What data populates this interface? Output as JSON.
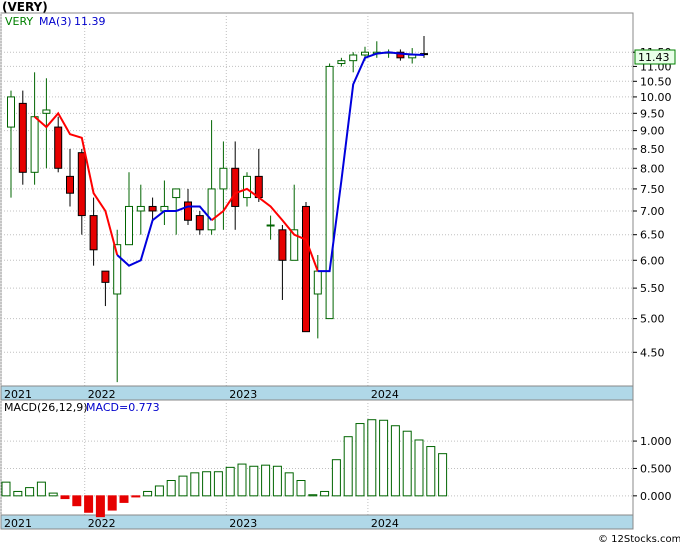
{
  "title": "(VERY)",
  "legend": {
    "symbol": "VERY",
    "ma_label": "MA(3)",
    "ma_value": "11.39",
    "symbol_color": "#008000",
    "ma_color": "#0000cc"
  },
  "last_price_badge": "11.43",
  "watermark": "© 12Stocks.com",
  "macd_legend": {
    "label": "MACD(26,12,9)",
    "value_label": "MACD=0.773"
  },
  "colors": {
    "up_fill": "#ffffff",
    "up_stroke": "#006400",
    "down_fill": "#e60000",
    "ma_red": "#ff0000",
    "ma_blue": "#0000dd",
    "grid": "#c0c0c0",
    "axis_band": "#b0d8e8",
    "badge_bg": "#e8ffe8",
    "badge_border": "#008000"
  },
  "chart_data": [
    {
      "type": "candlestick",
      "scale": "log",
      "ylim": [
        4.05,
        13.0
      ],
      "y_ticks": [
        "11.50",
        "11.00",
        "10.50",
        "10.00",
        "9.50",
        "9.00",
        "8.50",
        "8.00",
        "7.50",
        "7.00",
        "6.50",
        "6.00",
        "5.50",
        "5.00",
        "4.50"
      ],
      "x_ticks": [
        "2021",
        "2022",
        "2023",
        "2024"
      ],
      "x_tick_index": [
        0,
        6.5,
        18.5,
        30.5
      ],
      "candles": [
        {
          "o": 9.1,
          "h": 10.2,
          "l": 7.3,
          "c": 10.0
        },
        {
          "o": 9.8,
          "h": 10.2,
          "l": 7.6,
          "c": 7.9
        },
        {
          "o": 7.9,
          "h": 10.8,
          "l": 7.6,
          "c": 9.4
        },
        {
          "o": 9.5,
          "h": 10.6,
          "l": 8.0,
          "c": 9.6
        },
        {
          "o": 9.1,
          "h": 9.4,
          "l": 7.9,
          "c": 8.0
        },
        {
          "o": 7.8,
          "h": 8.5,
          "l": 7.1,
          "c": 7.4
        },
        {
          "o": 8.4,
          "h": 8.5,
          "l": 6.5,
          "c": 6.9
        },
        {
          "o": 6.9,
          "h": 7.3,
          "l": 5.9,
          "c": 6.2
        },
        {
          "o": 5.8,
          "h": 5.8,
          "l": 5.2,
          "c": 5.6
        },
        {
          "o": 5.4,
          "h": 6.6,
          "l": 4.1,
          "c": 6.3
        },
        {
          "o": 6.3,
          "h": 7.9,
          "l": 6.3,
          "c": 7.1
        },
        {
          "o": 7.0,
          "h": 7.6,
          "l": 6.5,
          "c": 7.1
        },
        {
          "o": 7.1,
          "h": 7.3,
          "l": 6.8,
          "c": 7.0
        },
        {
          "o": 7.0,
          "h": 7.7,
          "l": 6.7,
          "c": 7.1
        },
        {
          "o": 7.3,
          "h": 7.4,
          "l": 6.5,
          "c": 7.5
        },
        {
          "o": 7.2,
          "h": 7.5,
          "l": 6.7,
          "c": 6.8
        },
        {
          "o": 6.9,
          "h": 7.0,
          "l": 6.5,
          "c": 6.6
        },
        {
          "o": 6.6,
          "h": 9.3,
          "l": 6.5,
          "c": 7.5
        },
        {
          "o": 7.5,
          "h": 8.7,
          "l": 6.6,
          "c": 8.0
        },
        {
          "o": 8.0,
          "h": 8.7,
          "l": 6.6,
          "c": 7.1
        },
        {
          "o": 7.3,
          "h": 7.9,
          "l": 7.1,
          "c": 7.8
        },
        {
          "o": 7.8,
          "h": 8.5,
          "l": 7.2,
          "c": 7.3
        },
        {
          "o": 6.7,
          "h": 6.9,
          "l": 6.4,
          "c": 6.7
        },
        {
          "o": 6.6,
          "h": 6.7,
          "l": 5.3,
          "c": 6.0
        },
        {
          "o": 6.0,
          "h": 7.6,
          "l": 6.0,
          "c": 6.6
        },
        {
          "o": 7.1,
          "h": 7.2,
          "l": 4.8,
          "c": 4.8
        },
        {
          "o": 5.4,
          "h": 6.1,
          "l": 4.7,
          "c": 5.8
        },
        {
          "o": 5.0,
          "h": 11.1,
          "l": 5.0,
          "c": 11.0
        },
        {
          "o": 11.1,
          "h": 11.3,
          "l": 11.0,
          "c": 11.2
        },
        {
          "o": 11.2,
          "h": 11.5,
          "l": 10.8,
          "c": 11.4
        },
        {
          "o": 11.4,
          "h": 11.7,
          "l": 11.2,
          "c": 11.5
        },
        {
          "o": 11.45,
          "h": 11.9,
          "l": 11.3,
          "c": 11.5
        },
        {
          "o": 11.5,
          "h": 11.6,
          "l": 11.3,
          "c": 11.5
        },
        {
          "o": 11.5,
          "h": 11.6,
          "l": 11.2,
          "c": 11.3
        },
        {
          "o": 11.3,
          "h": 11.65,
          "l": 11.1,
          "c": 11.4
        },
        {
          "o": 11.45,
          "h": 12.1,
          "l": 11.3,
          "c": 11.43
        }
      ],
      "ma": [
        null,
        null,
        9.4,
        9.1,
        9.5,
        8.9,
        8.8,
        7.4,
        7.0,
        6.1,
        5.9,
        6.0,
        6.8,
        7.0,
        7.0,
        7.1,
        7.1,
        6.8,
        7.0,
        7.4,
        7.5,
        7.3,
        7.1,
        6.8,
        6.5,
        6.4,
        5.8,
        5.8,
        7.7,
        10.4,
        11.3,
        11.45,
        11.5,
        11.45,
        11.42,
        11.4
      ],
      "ma_split_index": 9
    },
    {
      "type": "bar",
      "title": "MACD(26,12,9)",
      "ylim": [
        -0.35,
        1.75
      ],
      "y_ticks": [
        "1.000",
        "0.500",
        "0.000"
      ],
      "x_ticks": [
        "2021",
        "2022",
        "2023",
        "2024"
      ],
      "values": [
        0.25,
        0.08,
        0.15,
        0.25,
        0.05,
        -0.05,
        -0.18,
        -0.3,
        -0.38,
        -0.26,
        -0.12,
        -0.02,
        0.08,
        0.18,
        0.28,
        0.36,
        0.42,
        0.44,
        0.44,
        0.52,
        0.58,
        0.54,
        0.56,
        0.54,
        0.42,
        0.28,
        0.02,
        0.08,
        0.66,
        1.08,
        1.32,
        1.39,
        1.38,
        1.28,
        1.18,
        1.02,
        0.9,
        0.77
      ]
    }
  ]
}
